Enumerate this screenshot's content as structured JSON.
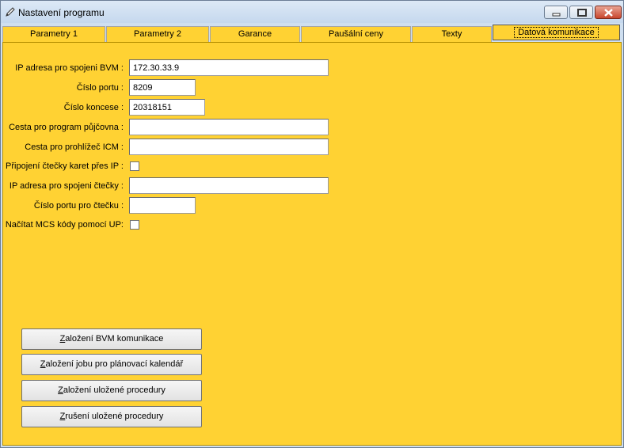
{
  "window": {
    "title": "Nastavení programu"
  },
  "tabs": [
    {
      "label": "Parametry 1"
    },
    {
      "label": "Parametry 2"
    },
    {
      "label": "Garance"
    },
    {
      "label": "Paušální ceny"
    },
    {
      "label": "Texty"
    },
    {
      "label": "Datová komunikace",
      "active": true
    }
  ],
  "form": {
    "ip_bvm": {
      "label": "IP adresa pro spojeni BVM :",
      "value": "172.30.33.9"
    },
    "port": {
      "label": "Číslo portu :",
      "value": "8209"
    },
    "concession": {
      "label": "Číslo koncese :",
      "value": "20318151"
    },
    "rental_path": {
      "label": "Cesta pro program půjčovna :",
      "value": ""
    },
    "icm_path": {
      "label": "Cesta pro prohlížeč ICM :",
      "value": ""
    },
    "reader_ip_checkbox": {
      "label": "Připojení čtečky karet přes IP :",
      "checked": false
    },
    "reader_ip": {
      "label": "IP adresa pro spojeni čtečky :",
      "value": ""
    },
    "reader_port": {
      "label": "Číslo portu pro čtečku :",
      "value": ""
    },
    "mcs_checkbox": {
      "label": "Načítat MCS kódy pomocí UP:",
      "checked": false
    }
  },
  "buttons": {
    "bvm_comm": {
      "mnemonic": "Z",
      "rest": "aložení BVM komunikace"
    },
    "job_calendar": {
      "mnemonic": "Z",
      "rest": "aložení jobu pro plánovací kalendář"
    },
    "create_procedure": {
      "mnemonic": "Z",
      "rest": "aložení uložené procedury"
    },
    "drop_procedure": {
      "mnemonic": "Z",
      "rest": "rušení uložené procedury"
    }
  },
  "colors": {
    "panel": "#ffd233",
    "titlebar": "#c5d8ee"
  }
}
